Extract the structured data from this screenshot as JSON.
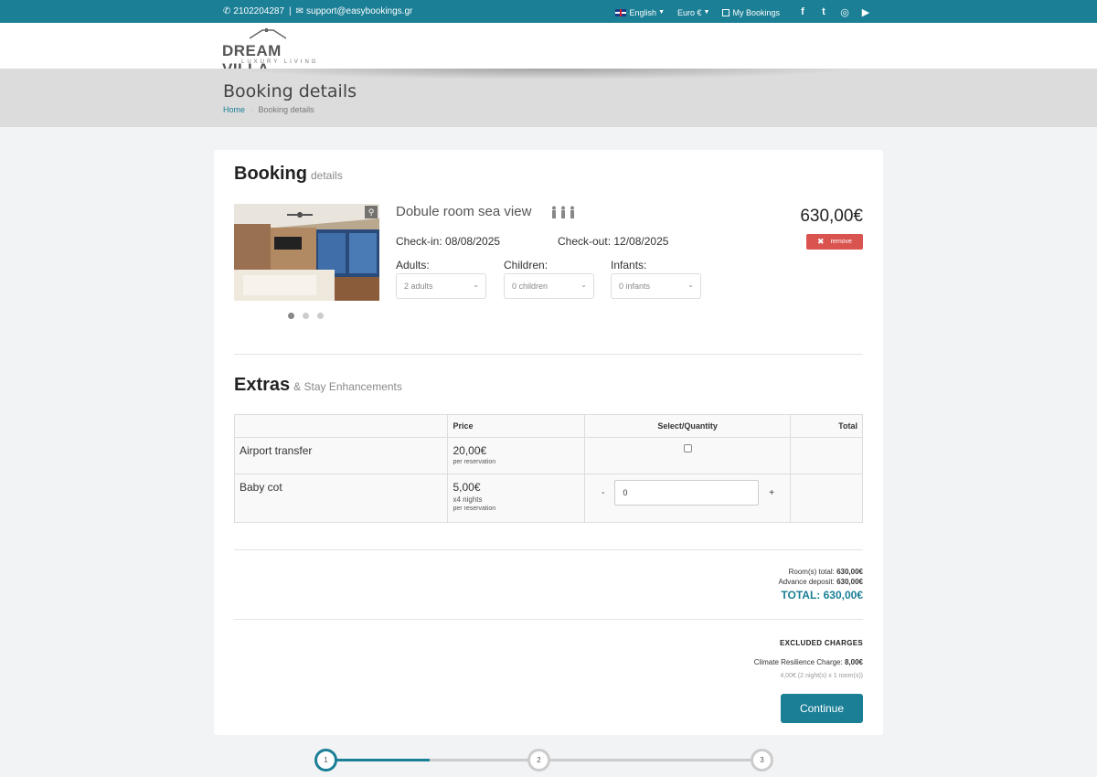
{
  "topbar": {
    "phone": "2102204287",
    "separator": "|",
    "email": "support@easybookings.gr",
    "language": "English",
    "currency": "Euro €",
    "my_bookings": "My Bookings",
    "social": {
      "facebook": "f",
      "twitter": "t",
      "instagram": "◎",
      "youtube": "▶"
    }
  },
  "logo": {
    "name": "DREAM VILLA",
    "tagline": "LUXURY LIVING"
  },
  "page": {
    "title": "Booking details",
    "breadcrumb_home": "Home",
    "breadcrumb_sep": "/",
    "breadcrumb_current": "Booking details"
  },
  "booking": {
    "title": "Booking",
    "subtitle": "details",
    "room_name": "Dobule room sea view",
    "checkin": "Check-in: 08/08/2025",
    "checkout": "Check-out: 12/08/2025",
    "price": "630,00€",
    "remove_label": "remove",
    "adults_label": "Adults:",
    "adults_value": "2 adults",
    "children_label": "Children:",
    "children_value": "0 children",
    "infants_label": "Infants:",
    "infants_value": "0 infants"
  },
  "extras": {
    "title": "Extras",
    "subtitle": "& Stay Enhancements",
    "headers": {
      "name": "",
      "price": "Price",
      "select": "Select/Quantity",
      "total": "Total"
    },
    "rows": [
      {
        "name": "Airport transfer",
        "price": "20,00€",
        "note1": "per reservation",
        "note2": ""
      },
      {
        "name": "Baby cot",
        "price": "5,00€",
        "note1": "x4 nights",
        "note2": "per reservation",
        "qty": "0",
        "minus": "-",
        "plus": "+"
      }
    ]
  },
  "totals": {
    "rooms_label": "Room(s) total:",
    "rooms_value": "630,00€",
    "deposit_label": "Advance deposit:",
    "deposit_value": "630,00€",
    "grand": "TOTAL: 630,00€"
  },
  "excluded": {
    "title": "EXCLUDED CHARGES",
    "label": "Climate Resilience Charge:",
    "value": "8,00€",
    "detail": "4,00€ (2 night(s) x 1 room(s))"
  },
  "continue_label": "Continue",
  "steps": [
    "1",
    "2",
    "3"
  ],
  "steps_completed": 1
}
